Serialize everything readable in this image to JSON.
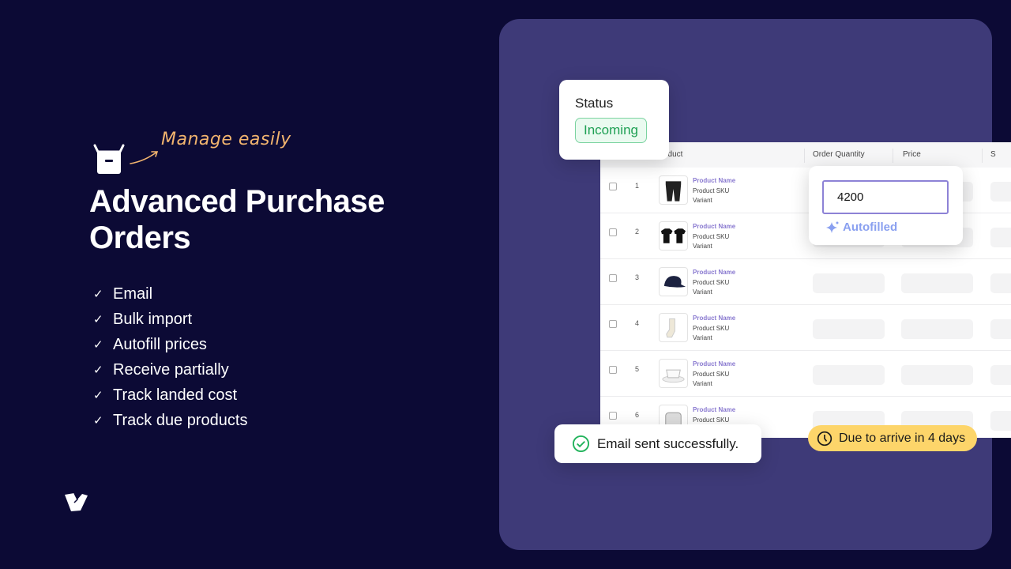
{
  "hero": {
    "tagline": "Manage easily",
    "title": "Advanced Purchase Orders",
    "features": [
      "Email",
      "Bulk import",
      "Autofill prices",
      "Receive partially",
      "Track landed cost",
      "Track due products"
    ]
  },
  "table": {
    "columns": [
      "Product",
      "Order Quantity",
      "Price",
      "S"
    ],
    "rows": [
      {
        "num": "1",
        "name": "Product Name",
        "sku": "Product SKU",
        "variant": "Variant",
        "image": "pants"
      },
      {
        "num": "2",
        "name": "Product Name",
        "sku": "Product SKU",
        "variant": "Variant",
        "image": "t-shirts"
      },
      {
        "num": "3",
        "name": "Product Name",
        "sku": "Product SKU",
        "variant": "Variant",
        "image": "cap"
      },
      {
        "num": "4",
        "name": "Product Name",
        "sku": "Product SKU",
        "variant": "Variant",
        "image": "socks"
      },
      {
        "num": "5",
        "name": "Product Name",
        "sku": "Product SKU",
        "variant": "Variant",
        "image": "cup"
      },
      {
        "num": "6",
        "name": "Product Name",
        "sku": "Product SKU",
        "variant": "",
        "image": "jar"
      }
    ]
  },
  "status_card": {
    "label": "Status",
    "value": "Incoming",
    "color": "#1fa054"
  },
  "autofill_card": {
    "value": "4200",
    "label": "Autofilled"
  },
  "toast": {
    "message": "Email sent successfully."
  },
  "due_badge": {
    "text": "Due to arrive in 4 days",
    "color": "#fdd56a"
  },
  "colors": {
    "background": "#0c0a35",
    "panel": "#3e3a78",
    "accent": "#f2b46e"
  }
}
